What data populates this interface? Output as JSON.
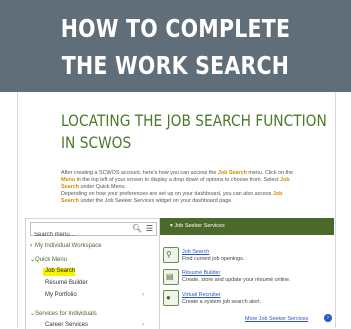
{
  "header": {
    "line1": "HOW TO COMPLETE",
    "line2": "THE WORK SEARCH"
  },
  "section": {
    "title_line1": "LOCATING THE JOB SEARCH FUNCTION",
    "title_line2": "IN SCWOS"
  },
  "paragraph1": {
    "a": "After creating a SCWOS account, here's how you can access the ",
    "b": "Job Search",
    "c": " menu. Click on the ",
    "d": "Menu",
    "e": " in the top left of your screen to display a drop down of options to choose from. Select ",
    "f": "Job Search",
    "g": " under Quick Menu."
  },
  "paragraph2": {
    "a": "Depending on how your preferences are set up on your dashboard, you can also access ",
    "b": "Job Search",
    "c": " under the Job Seeker Services widget on your dashboard page."
  },
  "menu": {
    "search_placeholder": "Search menu...",
    "search_icon": "search-icon",
    "menu_icon": "hamburger-icon",
    "workspace": "My Individual Workspace",
    "quick_menu": "Quick Menu",
    "job_search": "Job Search",
    "resume_builder": "Résumé Builder",
    "my_portfolio": "My Portfolio",
    "services": "Services for Individuals",
    "career_services": "Career Services",
    "highlight_color": "#f7f200"
  },
  "widget": {
    "title": "Job Seeker Services",
    "items": [
      {
        "icon": "search-icon",
        "link": "Job Search",
        "desc": "Find current job openings."
      },
      {
        "icon": "document-icon",
        "link": "Résumé Builder",
        "desc": "Create, store and update your résumé online."
      },
      {
        "icon": "recruiter-icon",
        "link": "Virtual Recruiter",
        "desc": "Create a system job search alert."
      }
    ],
    "more_link": "More Job Seeker Services",
    "more_icon": "arrow-circle-icon"
  },
  "colors": {
    "header_bg": "#5f6e78",
    "accent_green": "#4b6a2a",
    "link_blue": "#2a56c6",
    "highlight_orange": "#d58a00"
  }
}
